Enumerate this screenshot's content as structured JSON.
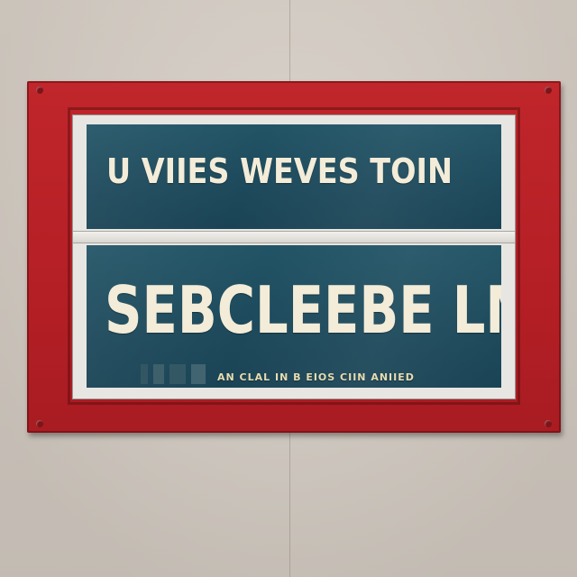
{
  "sign": {
    "top_text": "U VIIES WEVES TOIN",
    "main_text": "SEBCLEEBE LM",
    "small_text": "AN CLAL IN B EIOS CIIN ANIIED"
  },
  "colors": {
    "wall": "#d6cec5",
    "frame_red": "#b41f25",
    "window_white": "#e8e6e2",
    "glass_teal": "#1d4a5c",
    "lettering": "#f3ecd8"
  }
}
